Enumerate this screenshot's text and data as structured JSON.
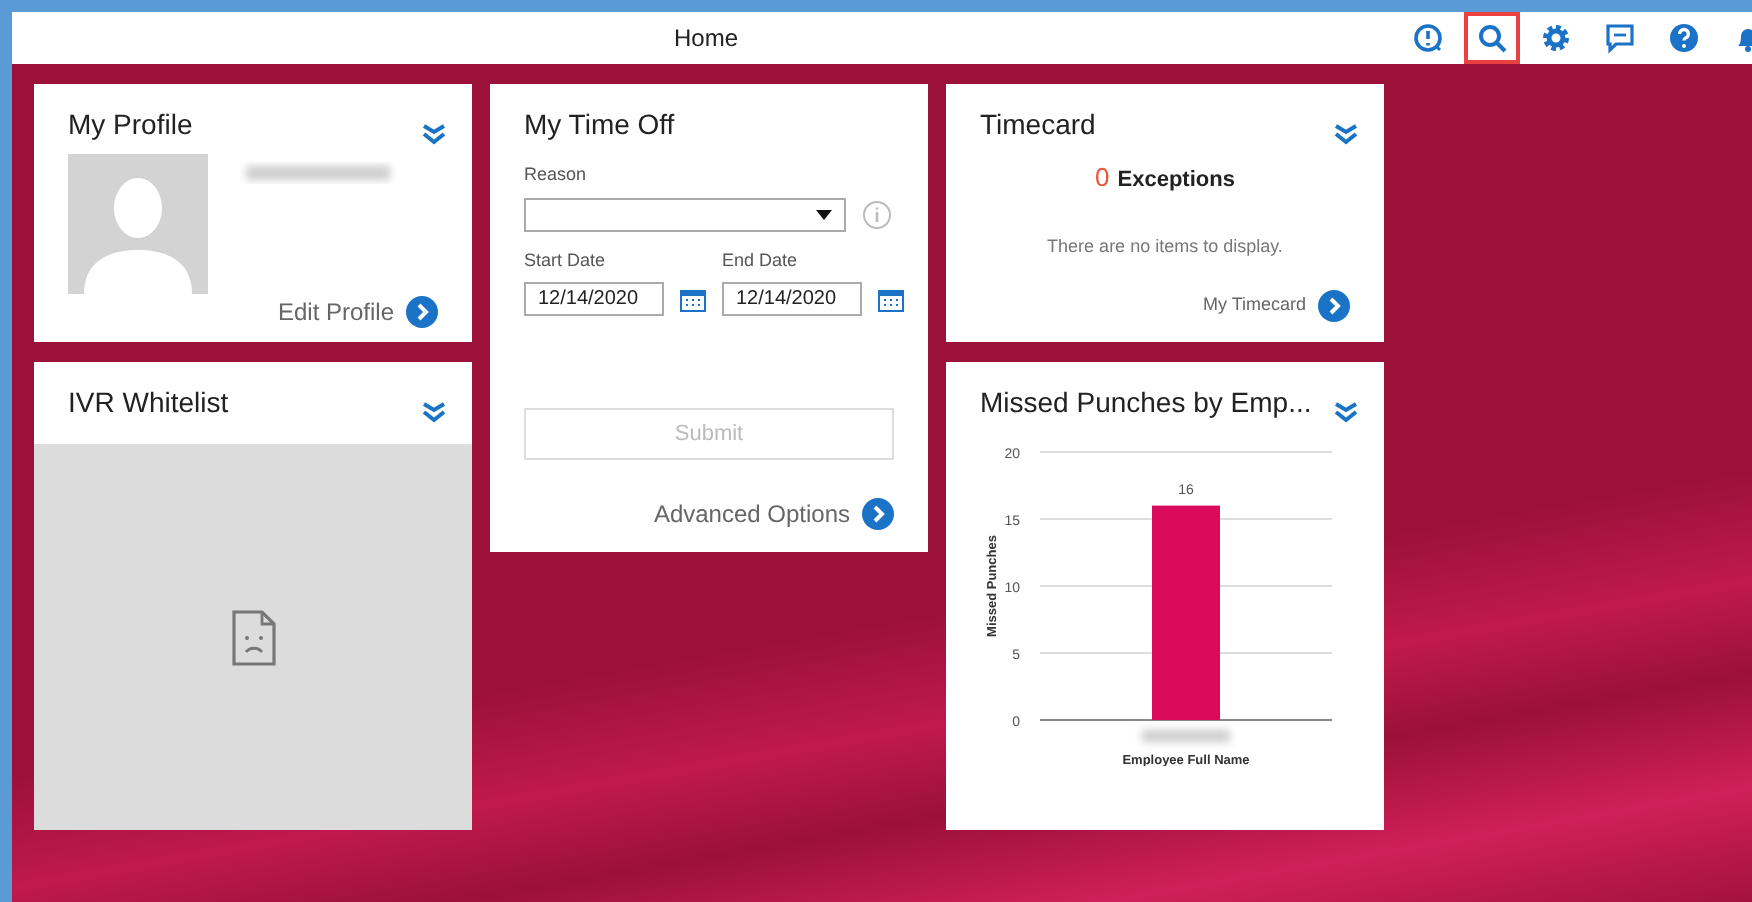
{
  "header": {
    "title": "Home",
    "tools": [
      {
        "kind": "alert-clock",
        "selected": false
      },
      {
        "kind": "search",
        "selected": true
      },
      {
        "kind": "settings",
        "selected": false
      },
      {
        "kind": "message",
        "selected": false
      },
      {
        "kind": "help",
        "selected": false
      },
      {
        "kind": "bell",
        "selected": false
      }
    ]
  },
  "profile": {
    "title": "My Profile",
    "link": "Edit Profile"
  },
  "ivr": {
    "title": "IVR Whitelist"
  },
  "time_off": {
    "title": "My Time Off",
    "reason_label": "Reason",
    "start_label": "Start Date",
    "start_value": "12/14/2020",
    "end_label": "End Date",
    "end_value": "12/14/2020",
    "submit": {
      "label": "Submit",
      "disabled": true
    },
    "link": "Advanced Options"
  },
  "timecard": {
    "title": "Timecard",
    "count": "0",
    "count_label": "Exceptions",
    "empty": "There are no items to display.",
    "link": "My Timecard"
  },
  "missed": {
    "title": "Missed Punches by Emp...",
    "chart_data": {
      "type": "bar",
      "xlabel": "Employee Full Name",
      "ylabel": "Missed Punches",
      "series": [
        {
          "color": "#d90b5a",
          "values": [
            16
          ]
        }
      ],
      "grid": true,
      "ylim": [
        0,
        20
      ],
      "yticks": [
        0,
        5,
        10,
        15,
        20
      ],
      "data_labels": true
    }
  }
}
